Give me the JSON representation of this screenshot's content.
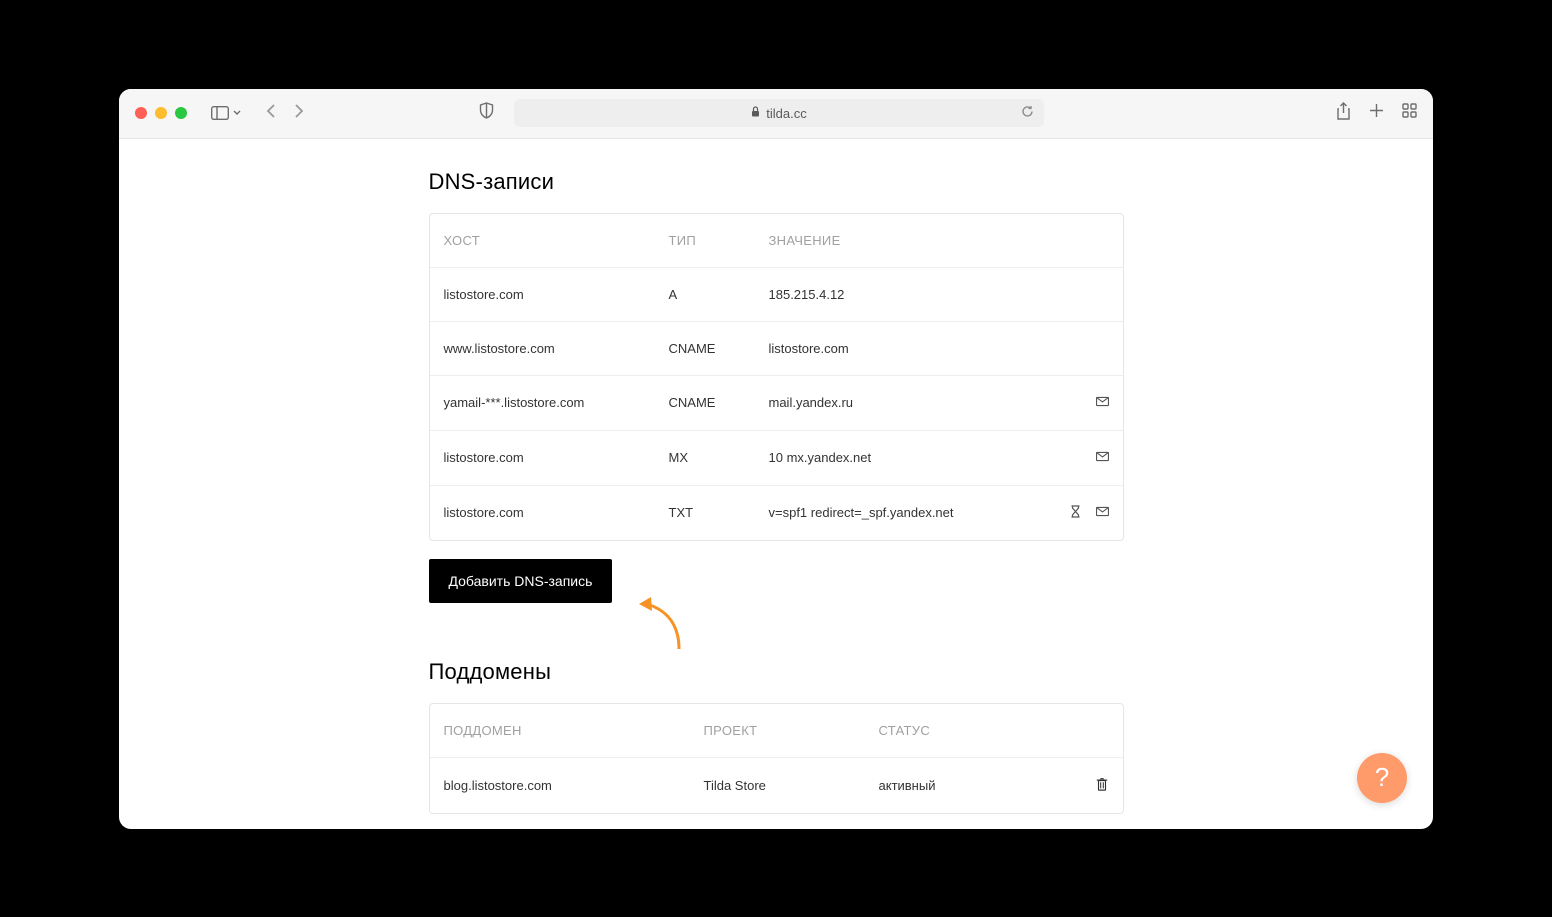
{
  "browser": {
    "url": "tilda.cc"
  },
  "dns": {
    "title": "DNS-записи",
    "headers": {
      "host": "ХОСТ",
      "type": "ТИП",
      "value": "ЗНАЧЕНИЕ"
    },
    "rows": [
      {
        "host": "listostore.com",
        "type": "A",
        "value": "185.215.4.12",
        "mail": false,
        "hourglass": false
      },
      {
        "host": "www.listostore.com",
        "type": "CNAME",
        "value": "listostore.com",
        "mail": false,
        "hourglass": false
      },
      {
        "host": "yamail-***.listostore.com",
        "type": "CNAME",
        "value": "mail.yandex.ru",
        "mail": true,
        "hourglass": false
      },
      {
        "host": "listostore.com",
        "type": "MX",
        "value": "10 mx.yandex.net",
        "mail": true,
        "hourglass": false
      },
      {
        "host": "listostore.com",
        "type": "TXT",
        "value": "v=spf1 redirect=_spf.yandex.net",
        "mail": true,
        "hourglass": true
      }
    ],
    "add_label": "Добавить DNS-запись"
  },
  "subdomains": {
    "title": "Поддомены",
    "headers": {
      "subdomain": "ПОДДОМЕН",
      "project": "ПРОЕКТ",
      "status": "СТАТУС"
    },
    "rows": [
      {
        "subdomain": "blog.listostore.com",
        "project": "Tilda Store",
        "status": "активный"
      }
    ]
  },
  "help": {
    "label": "?"
  }
}
